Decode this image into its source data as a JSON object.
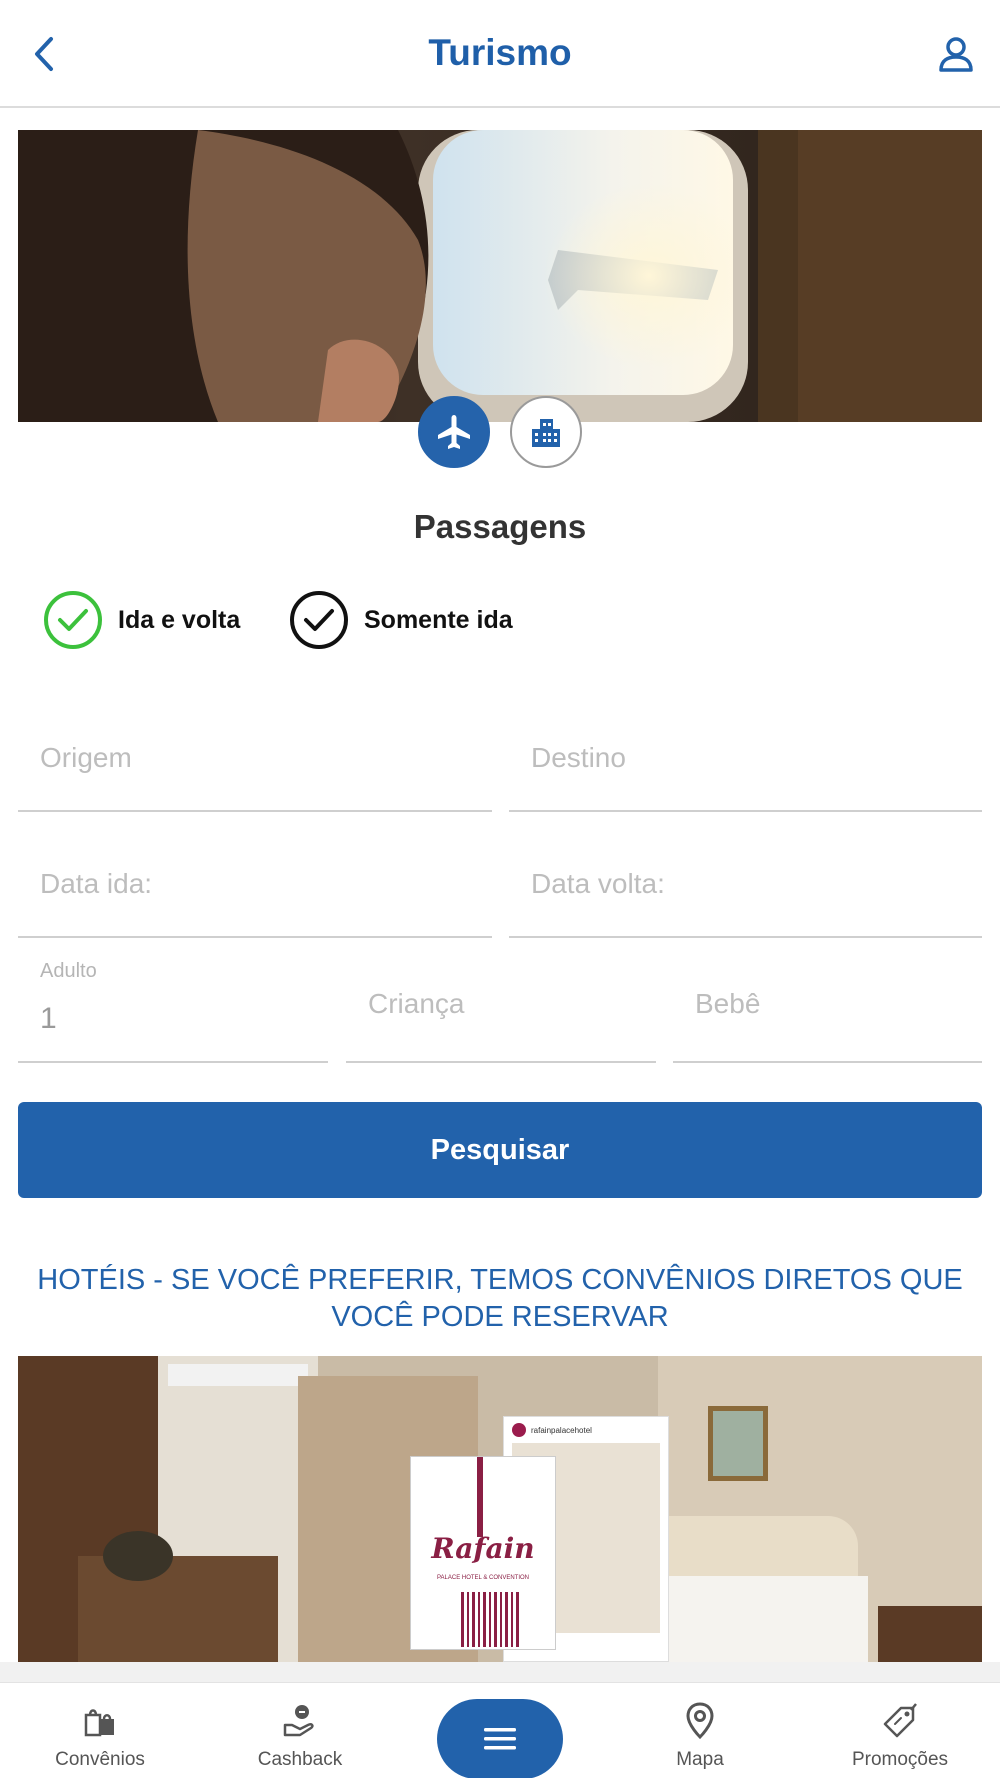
{
  "header": {
    "title": "Turismo",
    "back_icon": "chevron-left-icon",
    "profile_icon": "user-icon"
  },
  "hero": {
    "image_subject": "woman-looking-out-airplane-window"
  },
  "mode_buttons": [
    {
      "icon": "airplane-icon",
      "selected": true
    },
    {
      "icon": "building-icon",
      "selected": false
    }
  ],
  "section": {
    "title": "Passagens"
  },
  "trip_type": {
    "round_trip_label": "Ida e volta",
    "one_way_label": "Somente ida"
  },
  "form": {
    "origem_placeholder": "Origem",
    "destino_placeholder": "Destino",
    "data_ida_placeholder": "Data ida:",
    "data_volta_placeholder": "Data volta:",
    "adulto_label": "Adulto",
    "adulto_value": "1",
    "crianca_placeholder": "Criança",
    "bebe_placeholder": "Bebê"
  },
  "search_button": {
    "label": "Pesquisar"
  },
  "hotels": {
    "heading": "HOTÉIS - SE VOCÊ PREFERIR, TEMOS CONVÊNIOS DIRETOS QUE VOCÊ PODE RESERVAR",
    "banner_logo_text": "Rafain",
    "banner_logo_sub": "PALACE HOTEL & CONVENTION",
    "banner_social_handle": "rafainpalacehotel"
  },
  "tabbar": {
    "items": [
      {
        "label": "Convênios",
        "icon": "shopping-bags-icon"
      },
      {
        "label": "Cashback",
        "icon": "hand-coin-icon"
      },
      {
        "label": "Mapa",
        "icon": "map-pin-icon"
      },
      {
        "label": "Promoções",
        "icon": "price-tag-icon"
      }
    ],
    "menu_icon": "menu-icon"
  },
  "colors": {
    "primary": "#2262ab",
    "title_blue": "#1f5fa9",
    "check_green": "#3cc13c",
    "placeholder_gray": "#bdbdbd"
  }
}
